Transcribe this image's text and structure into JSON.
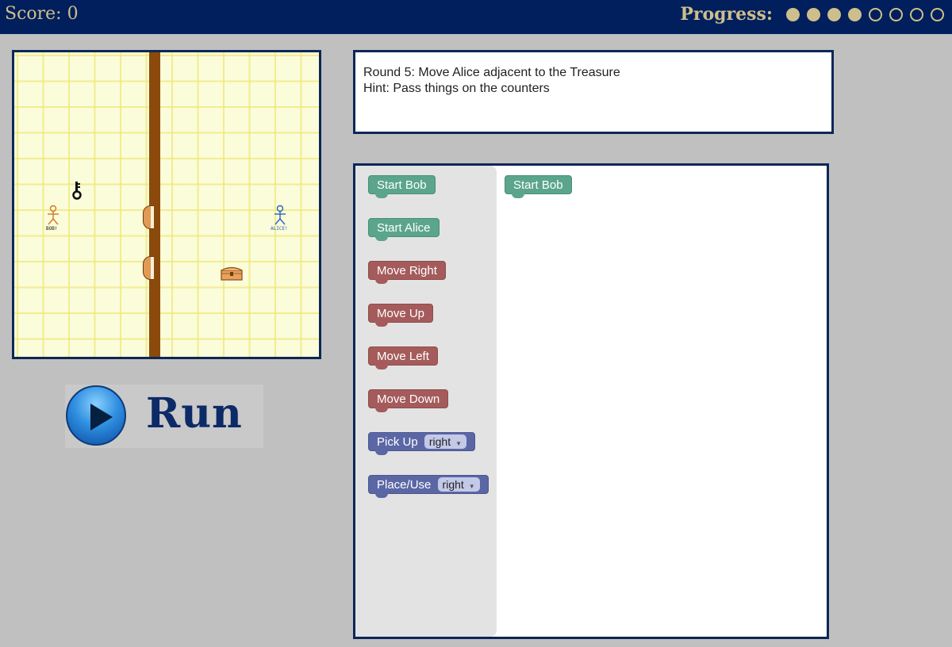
{
  "header": {
    "score_text": "Score: 0",
    "progress_label": "Progress:",
    "progress": {
      "completed": 4,
      "total": 8
    }
  },
  "board": {
    "characters": {
      "bob_label": "BOB!",
      "alice_label": "ALICE!"
    },
    "items": [
      "key-icon",
      "treasure-chest-icon"
    ],
    "colors": {
      "tile": "#fbfcd9",
      "grid": "#eee878",
      "wall": "#8b4a0c",
      "border": "#0c2758"
    }
  },
  "instructions": {
    "round": "Round 5: Move Alice adjacent to the Treasure",
    "hint": "Hint: Pass things on the counters"
  },
  "toolbox": {
    "blocks": [
      {
        "label": "Start Bob",
        "kind": "start"
      },
      {
        "label": "Start Alice",
        "kind": "start"
      },
      {
        "label": "Move Right",
        "kind": "move"
      },
      {
        "label": "Move Up",
        "kind": "move"
      },
      {
        "label": "Move Left",
        "kind": "move"
      },
      {
        "label": "Move Down",
        "kind": "move"
      },
      {
        "label": "Pick Up",
        "kind": "action",
        "option": "right"
      },
      {
        "label": "Place/Use",
        "kind": "action",
        "option": "right"
      }
    ],
    "colors": {
      "start": "#5ba58c",
      "move": "#a55b5b",
      "action": "#5b67a5"
    }
  },
  "workspace": {
    "blocks": [
      {
        "label": "Start Bob"
      }
    ]
  },
  "run_button": {
    "label": "Run"
  }
}
